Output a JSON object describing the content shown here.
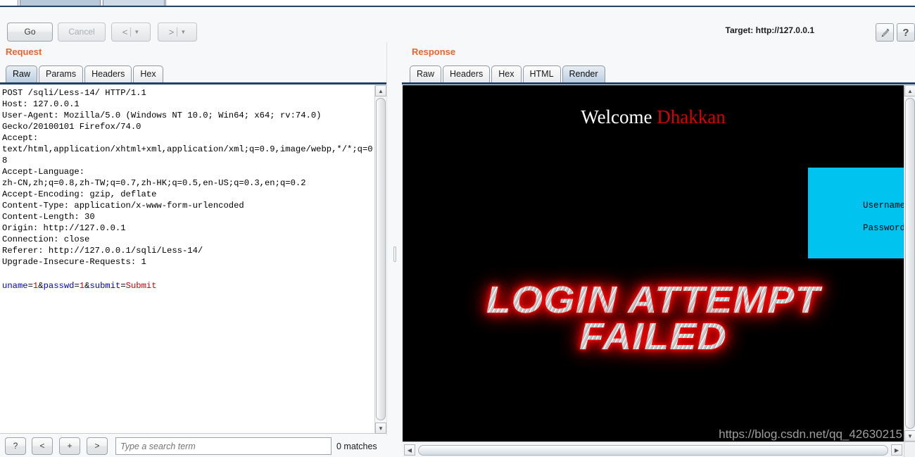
{
  "window": {
    "tabstrip_present": true
  },
  "toolbar": {
    "go_label": "Go",
    "cancel_label": "Cancel",
    "back_arrow": "<",
    "forward_arrow": ">",
    "caret": "▼",
    "target_label": "Target: http://127.0.0.1",
    "edit_icon": "pencil-icon",
    "help_label": "?"
  },
  "request": {
    "heading": "Request",
    "tabs": [
      {
        "label": "Raw",
        "active": true
      },
      {
        "label": "Params",
        "active": false
      },
      {
        "label": "Headers",
        "active": false
      },
      {
        "label": "Hex",
        "active": false
      }
    ],
    "raw_headers": "POST /sqli/Less-14/ HTTP/1.1\nHost: 127.0.0.1\nUser-Agent: Mozilla/5.0 (Windows NT 10.0; Win64; x64; rv:74.0)\nGecko/20100101 Firefox/74.0\nAccept:\ntext/html,application/xhtml+xml,application/xml;q=0.9,image/webp,*/*;q=0.8\nAccept-Language:\nzh-CN,zh;q=0.8,zh-TW;q=0.7,zh-HK;q=0.5,en-US;q=0.3,en;q=0.2\nAccept-Encoding: gzip, deflate\nContent-Type: application/x-www-form-urlencoded\nContent-Length: 30\nOrigin: http://127.0.0.1\nConnection: close\nReferer: http://127.0.0.1/sqli/Less-14/\nUpgrade-Insecure-Requests: 1",
    "body": {
      "param1_name": "uname",
      "param1_value": "1",
      "param2_name": "passwd",
      "param2_value": "1",
      "param3_name": "submit",
      "param3_value": "Submit",
      "full": "uname=1&passwd=1&submit=Submit"
    },
    "search": {
      "help_label": "?",
      "prev_label": "<",
      "add_label": "+",
      "next_label": ">",
      "placeholder": "Type a search term",
      "value": "",
      "match_count": "0 matches"
    }
  },
  "response": {
    "heading": "Response",
    "tabs": [
      {
        "label": "Raw",
        "active": false
      },
      {
        "label": "Headers",
        "active": false
      },
      {
        "label": "Hex",
        "active": false
      },
      {
        "label": "HTML",
        "active": false
      },
      {
        "label": "Render",
        "active": true
      }
    ],
    "render": {
      "welcome_prefix": "Welcome ",
      "welcome_user": "Dhakkan",
      "login_box": {
        "username_label": "Username :",
        "password_label": "Password :",
        "background_color": "#00c3f0"
      },
      "banner_line1": "LOGIN ATTEMPT",
      "banner_line2": "FAILED",
      "watermark": "https://blog.csdn.net/qq_42630215",
      "background_color": "#000000"
    }
  },
  "scrollbars": {
    "up_arrow": "▲",
    "down_arrow": "▼",
    "left_arrow": "◀",
    "right_arrow": "▶"
  },
  "colors": {
    "heading_orange": "#e8662a",
    "tab_underline": "#21426b",
    "param_name": "#0000cc",
    "param_value": "#cc0000"
  }
}
